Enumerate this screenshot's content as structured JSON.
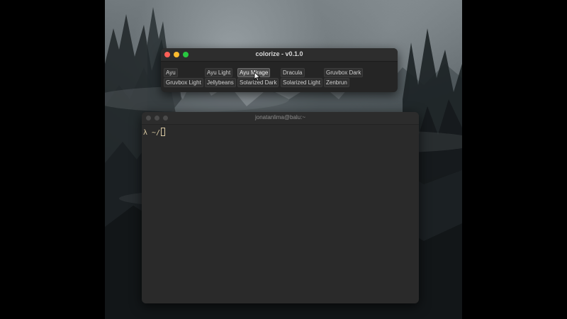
{
  "colors": {
    "close": "#fe5f57",
    "minimize": "#febc2e",
    "maximize": "#28c840",
    "terminal_bg": "#2a2a2a",
    "prompt_fg": "#d9c9a3"
  },
  "app_window": {
    "title": "colorize - v0.1.0",
    "active_theme": "Ayu Mirage",
    "themes": [
      "Ayu",
      "Ayu Light",
      "Ayu Mirage",
      "Dracula",
      "Gruvbox Dark",
      "Gruvbox Light",
      "Jellybeans",
      "Solarized Dark",
      "Solarized Light",
      "Zenbrun"
    ]
  },
  "terminal": {
    "title": "jonatanlima@balu:~",
    "prompt": "λ ~/"
  }
}
